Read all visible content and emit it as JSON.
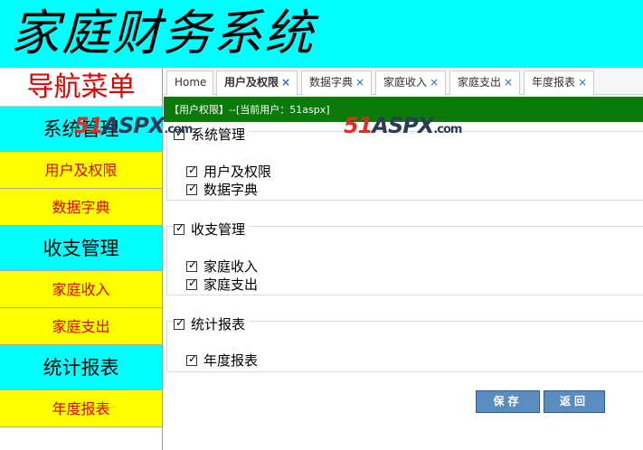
{
  "header": {
    "title": "家庭财务系统"
  },
  "sidebar": {
    "title": "导航菜单",
    "groups": [
      {
        "label": "系统管理",
        "items": [
          {
            "label": "用户及权限"
          },
          {
            "label": "数据字典"
          }
        ]
      },
      {
        "label": "收支管理",
        "items": [
          {
            "label": "家庭收入"
          },
          {
            "label": "家庭支出"
          }
        ]
      },
      {
        "label": "统计报表",
        "items": [
          {
            "label": "年度报表"
          }
        ]
      }
    ]
  },
  "tabs": [
    {
      "label": "Home",
      "closable": false
    },
    {
      "label": "用户及权限",
      "closable": true,
      "active": true
    },
    {
      "label": "数据字典",
      "closable": true
    },
    {
      "label": "家庭收入",
      "closable": true
    },
    {
      "label": "家庭支出",
      "closable": true
    },
    {
      "label": "年度报表",
      "closable": true
    }
  ],
  "tab_close_glyph": "×",
  "permission": {
    "text": "【用户权限】--[当前用户：51aspx]"
  },
  "sections": [
    {
      "label": "系统管理",
      "checked": true,
      "items": [
        {
          "label": "用户及权限",
          "checked": true
        },
        {
          "label": "数据字典",
          "checked": true
        }
      ]
    },
    {
      "label": "收支管理",
      "checked": true,
      "items": [
        {
          "label": "家庭收入",
          "checked": true
        },
        {
          "label": "家庭支出",
          "checked": true
        }
      ]
    },
    {
      "label": "统计报表",
      "checked": true,
      "items": [
        {
          "label": "年度报表",
          "checked": true
        }
      ]
    }
  ],
  "watermark": {
    "part1": "51",
    "part2": "ASPX",
    "part3": ".com"
  },
  "buttons": {
    "save": "保存",
    "back": "返回"
  },
  "colors": {
    "header_bg": "#00ffff",
    "nav_group_bg": "#00ffff",
    "nav_item_bg": "#ffff00",
    "nav_item_text": "#e00000",
    "permission_bar": "#0a7a0a",
    "button_bg": "#5b8cc0"
  },
  "icons": {
    "checkbox": "checkbox-checked-icon",
    "tab_close": "close-icon"
  }
}
